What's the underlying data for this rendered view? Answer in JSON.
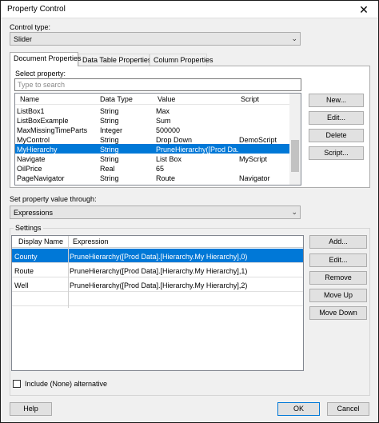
{
  "window": {
    "title": "Property Control",
    "close_glyph": "✕"
  },
  "control_type": {
    "label": "Control type:",
    "value": "Slider"
  },
  "tabs": [
    {
      "label": "Document Properties"
    },
    {
      "label": "Data Table Properties"
    },
    {
      "label": "Column Properties"
    }
  ],
  "select_property": {
    "label": "Select property:",
    "search_placeholder": "Type to search",
    "columns": [
      "Name",
      "Data Type",
      "Value",
      "Script"
    ],
    "rows": [
      [
        "ListBox1",
        "String",
        "Max",
        ""
      ],
      [
        "ListBoxExample",
        "String",
        "Sum",
        ""
      ],
      [
        "MaxMissingTimeParts",
        "Integer",
        "500000",
        ""
      ],
      [
        "MyControl",
        "String",
        "Drop Down",
        "DemoScript"
      ],
      [
        "MyHierarchy",
        "String",
        "PruneHierarchy([Prod Da...",
        ""
      ],
      [
        "Navigate",
        "String",
        "List Box",
        "MyScript"
      ],
      [
        "OilPrice",
        "Real",
        "65",
        ""
      ],
      [
        "PageNavigator",
        "String",
        "Route",
        "Navigator"
      ]
    ],
    "selected_index": 4
  },
  "property_buttons": {
    "new": "New...",
    "edit": "Edit...",
    "delete": "Delete",
    "script": "Script..."
  },
  "set_through": {
    "label": "Set property value through:",
    "value": "Expressions"
  },
  "settings": {
    "label": "Settings",
    "columns": [
      "Display Name",
      "Expression"
    ],
    "rows": [
      [
        "County",
        "PruneHierarchy([Prod Data].[Hierarchy.My Hierarchy],0)"
      ],
      [
        "Route",
        "PruneHierarchy([Prod Data].[Hierarchy.My Hierarchy],1)"
      ],
      [
        "Well",
        "PruneHierarchy([Prod Data].[Hierarchy.My Hierarchy],2)"
      ]
    ],
    "selected_index": 0
  },
  "settings_buttons": {
    "add": "Add...",
    "edit": "Edit...",
    "remove": "Remove",
    "move_up": "Move Up",
    "move_down": "Move Down"
  },
  "include_none": {
    "label": "Include (None) alternative",
    "checked": false
  },
  "footer": {
    "help": "Help",
    "ok": "OK",
    "cancel": "Cancel"
  },
  "colors": {
    "selection": "#0078d7",
    "button_face": "#e1e1e1",
    "dialog_bg": "#f0f0f0"
  }
}
